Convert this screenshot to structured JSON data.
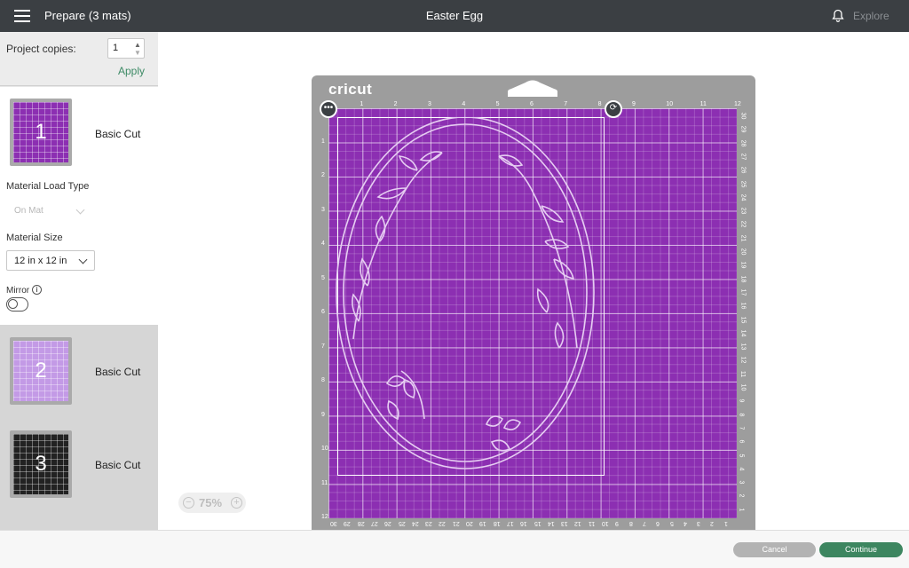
{
  "header": {
    "title": "Prepare (3 mats)",
    "project_name": "Easter Egg",
    "explore_label": "Explore",
    "menu_icon": "hamburger-icon",
    "notification_icon": "bell-icon"
  },
  "sidebar": {
    "copies_label": "Project copies:",
    "copies_value": "1",
    "apply_label": "Apply",
    "mats": [
      {
        "number": "1",
        "label": "Basic Cut",
        "color": "#8c2fb2"
      },
      {
        "number": "2",
        "label": "Basic Cut",
        "color": "#c39ae6"
      },
      {
        "number": "3",
        "label": "Basic Cut",
        "color": "#222222"
      }
    ],
    "material_load_type_label": "Material Load Type",
    "material_load_type_value": "On Mat",
    "material_size_label": "Material Size",
    "material_size_value": "12 in x 12 in",
    "mirror_label": "Mirror",
    "mirror_on": false
  },
  "canvas": {
    "brand": "cricut",
    "mat_color": "#8c2fb2",
    "ruler_top": [
      "1",
      "2",
      "3",
      "4",
      "5",
      "6",
      "7",
      "8",
      "9",
      "10",
      "11",
      "12"
    ],
    "ruler_left": [
      "1",
      "2",
      "3",
      "4",
      "5",
      "6",
      "7",
      "8",
      "9",
      "10",
      "11",
      "12"
    ],
    "ruler_right": [
      "30",
      "29",
      "28",
      "27",
      "26",
      "25",
      "24",
      "23",
      "22",
      "21",
      "20",
      "19",
      "18",
      "17",
      "16",
      "15",
      "14",
      "13",
      "12",
      "11",
      "10",
      "9",
      "8",
      "7",
      "6",
      "5",
      "4",
      "3",
      "2",
      "1"
    ],
    "ruler_bottom": [
      "30",
      "29",
      "28",
      "27",
      "26",
      "25",
      "24",
      "23",
      "22",
      "21",
      "20",
      "19",
      "18",
      "17",
      "16",
      "15",
      "14",
      "13",
      "12",
      "11",
      "10",
      "9",
      "8",
      "7",
      "6",
      "5",
      "4",
      "3",
      "2",
      "1"
    ],
    "more_icon": "more-options-icon",
    "rotate_icon": "rotate-icon",
    "zoom_value": "75%"
  },
  "footer": {
    "cancel_label": "Cancel",
    "continue_label": "Continue"
  }
}
